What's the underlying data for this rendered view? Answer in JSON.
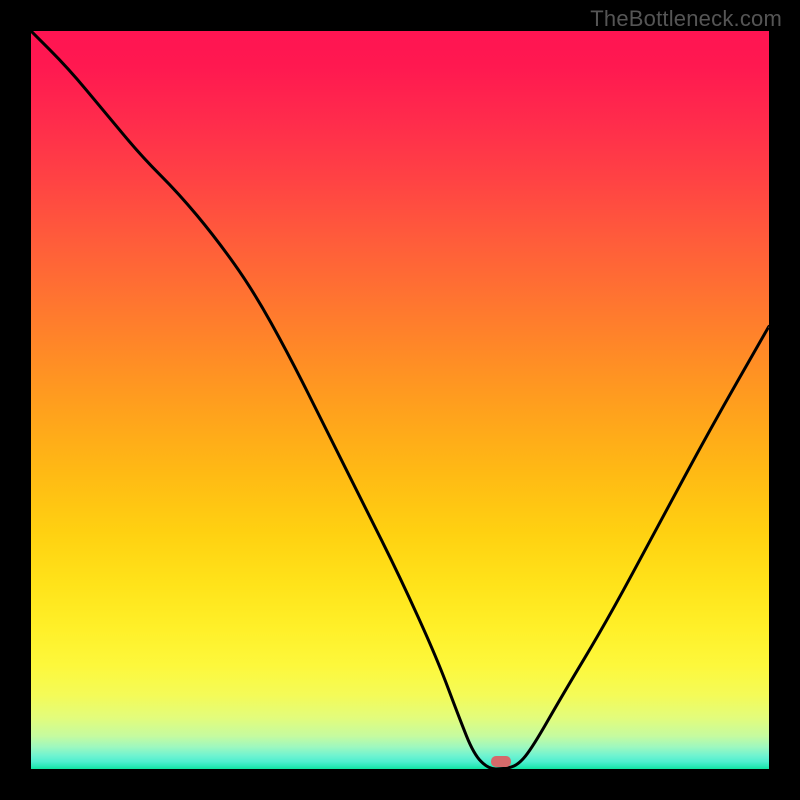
{
  "watermark": "TheBottleneck.com",
  "background_color": "#000000",
  "gradient_colors": {
    "top": "#ff1452",
    "bottom": "#10e3a0"
  },
  "tick_marker": {
    "x_pct": 63.7,
    "y_pct": 99.0,
    "color": "#d56a6a",
    "width": 20,
    "height": 11
  },
  "chart_data": {
    "type": "line",
    "title": "",
    "xlabel": "",
    "ylabel": "",
    "xlim": [
      0,
      100
    ],
    "ylim": [
      0,
      100
    ],
    "description": "V-shaped bottleneck curve on red-to-green gradient (red=high bottleneck at top to green=0% at bottom). Minimum around x≈63.",
    "series": [
      {
        "name": "bottleneck-curve",
        "x": [
          0,
          5,
          10,
          15,
          20,
          25,
          30,
          35,
          40,
          45,
          50,
          55,
          58,
          60,
          62,
          64,
          66,
          68,
          72,
          78,
          85,
          92,
          100
        ],
        "y": [
          100,
          95,
          89,
          83,
          78,
          72,
          65,
          56,
          46,
          36,
          26,
          15,
          7,
          2,
          0,
          0,
          0.5,
          3,
          10,
          20,
          33,
          46,
          60
        ]
      }
    ],
    "marker": {
      "x": 63.7,
      "y": 0,
      "color": "#d56a6a"
    }
  }
}
